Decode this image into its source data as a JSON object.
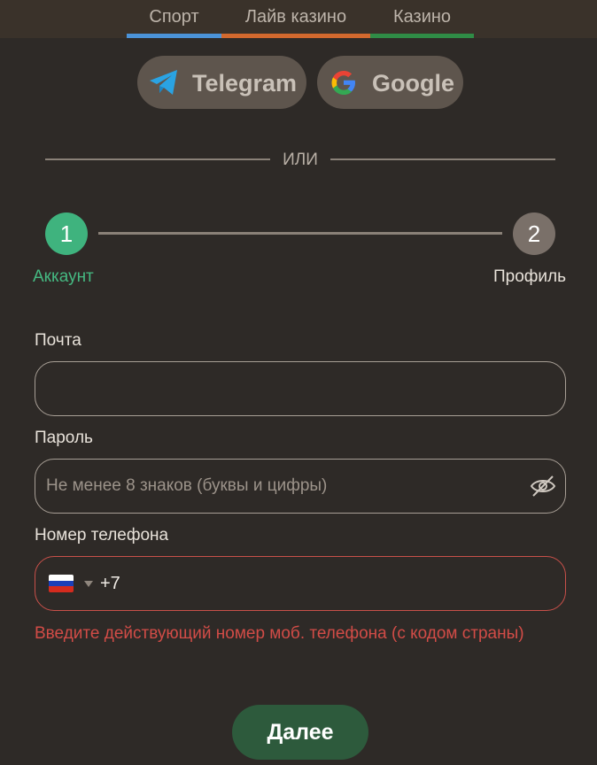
{
  "nav": {
    "tabs": [
      {
        "label": "Спорт",
        "color": "#4b93d8"
      },
      {
        "label": "Лайв казино",
        "color": "#d2692e"
      },
      {
        "label": "Казино",
        "color": "#2f8c46"
      }
    ]
  },
  "social": {
    "telegram_label": "Telegram",
    "google_label": "Google"
  },
  "divider": {
    "text": "ИЛИ"
  },
  "steps": [
    {
      "number": "1",
      "label": "Аккаунт",
      "state": "active"
    },
    {
      "number": "2",
      "label": "Профиль",
      "state": "inactive"
    }
  ],
  "form": {
    "email": {
      "label": "Почта",
      "value": "",
      "placeholder": ""
    },
    "password": {
      "label": "Пароль",
      "value": "",
      "placeholder": "Не менее 8 знаков (буквы и цифры)"
    },
    "phone": {
      "label": "Номер телефона",
      "country_flag": "russia-flag",
      "code": "+7",
      "value": ""
    },
    "error": "Введите действующий номер моб. телефона (с кодом страны)"
  },
  "submit": {
    "label": "Далее"
  },
  "colors": {
    "background": "#2e2a27",
    "accent_green": "#3fb37e",
    "error_red": "#d24c47",
    "button_green": "#2d5a3c"
  }
}
